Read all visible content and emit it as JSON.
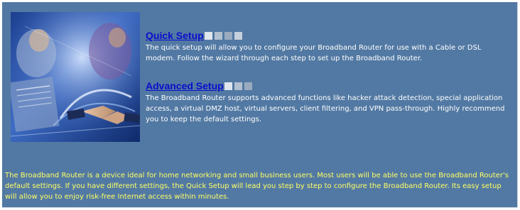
{
  "quick_setup": {
    "title": "Quick Setup",
    "description": "The quick setup will allow you to configure your Broadband Router for use with a Cable or DSL modem. Follow the wizard through each step to set up the Broadband Router."
  },
  "advanced_setup": {
    "title": "Advanced Setup",
    "description": "The Broadband Router supports advanced functions like hacker attack detection, special application access, a virtual DMZ host, virtual servers, client filtering, and VPN pass-through. Highly recommend you to keep the default settings."
  },
  "footer": {
    "text": "The Broadband Router is a device ideal for home networking and small business users. Most users will be able to use the Broadband Router's default settings. If you have different settings, the Quick Setup will lead you step by step to configure the Broadband Router. Its easy setup will allow you to enjoy risk-free Internet access within minutes."
  },
  "colors": {
    "panel_bg": "#5279a3",
    "link": "#0c0ccc",
    "body_text": "#ffffff",
    "footer_text": "#ffff66"
  },
  "icons": {
    "hero_image": "business-handshake-collage-image",
    "title_decoration": "gray-squares-decoration"
  }
}
